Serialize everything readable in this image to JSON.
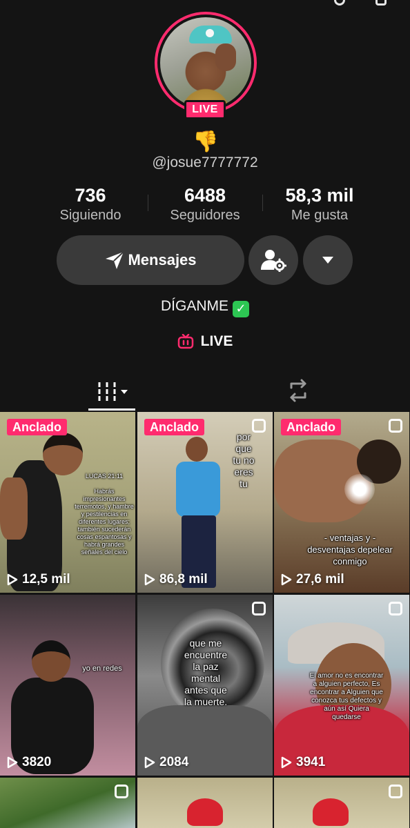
{
  "profile": {
    "live_badge": "LIVE",
    "emoji": "👎",
    "handle": "@josue7777772"
  },
  "stats": [
    {
      "value": "736",
      "label": "Siguiendo"
    },
    {
      "value": "6488",
      "label": "Seguidores"
    },
    {
      "value": "58,3 mil",
      "label": "Me gusta"
    }
  ],
  "actions": {
    "message_label": "Mensajes"
  },
  "bio": "DÍGANME",
  "live_link": "LIVE",
  "pinned_label": "Anclado",
  "videos": [
    {
      "views": "12,5 mil",
      "pinned": true,
      "caption": "LUCAS 21:11\n\nHabrás impresionantes terremotos, y hambre y pestilencias en diferentes lugares; también sucederán cosas espantosas y habrá grandes señales del cielo"
    },
    {
      "views": "86,8 mil",
      "pinned": true,
      "caption": "por que tu no eres tu"
    },
    {
      "views": "27,6 mil",
      "pinned": true,
      "caption": "- ventajas y - desventajas depelear conmigo"
    },
    {
      "views": "3820",
      "pinned": false,
      "caption": "yo en redes"
    },
    {
      "views": "2084",
      "pinned": false,
      "caption": "que me encuentre la paz mental antes que la muerte."
    },
    {
      "views": "3941",
      "pinned": false,
      "caption": "El amor no es encontrar a alguien perfecto, Es encontrar a Alguien que conozca tus defectos y aún así Quiera quedarse"
    }
  ],
  "colors": {
    "accent": "#ff2b6e",
    "background": "#141414",
    "button": "#3a3a3a"
  }
}
